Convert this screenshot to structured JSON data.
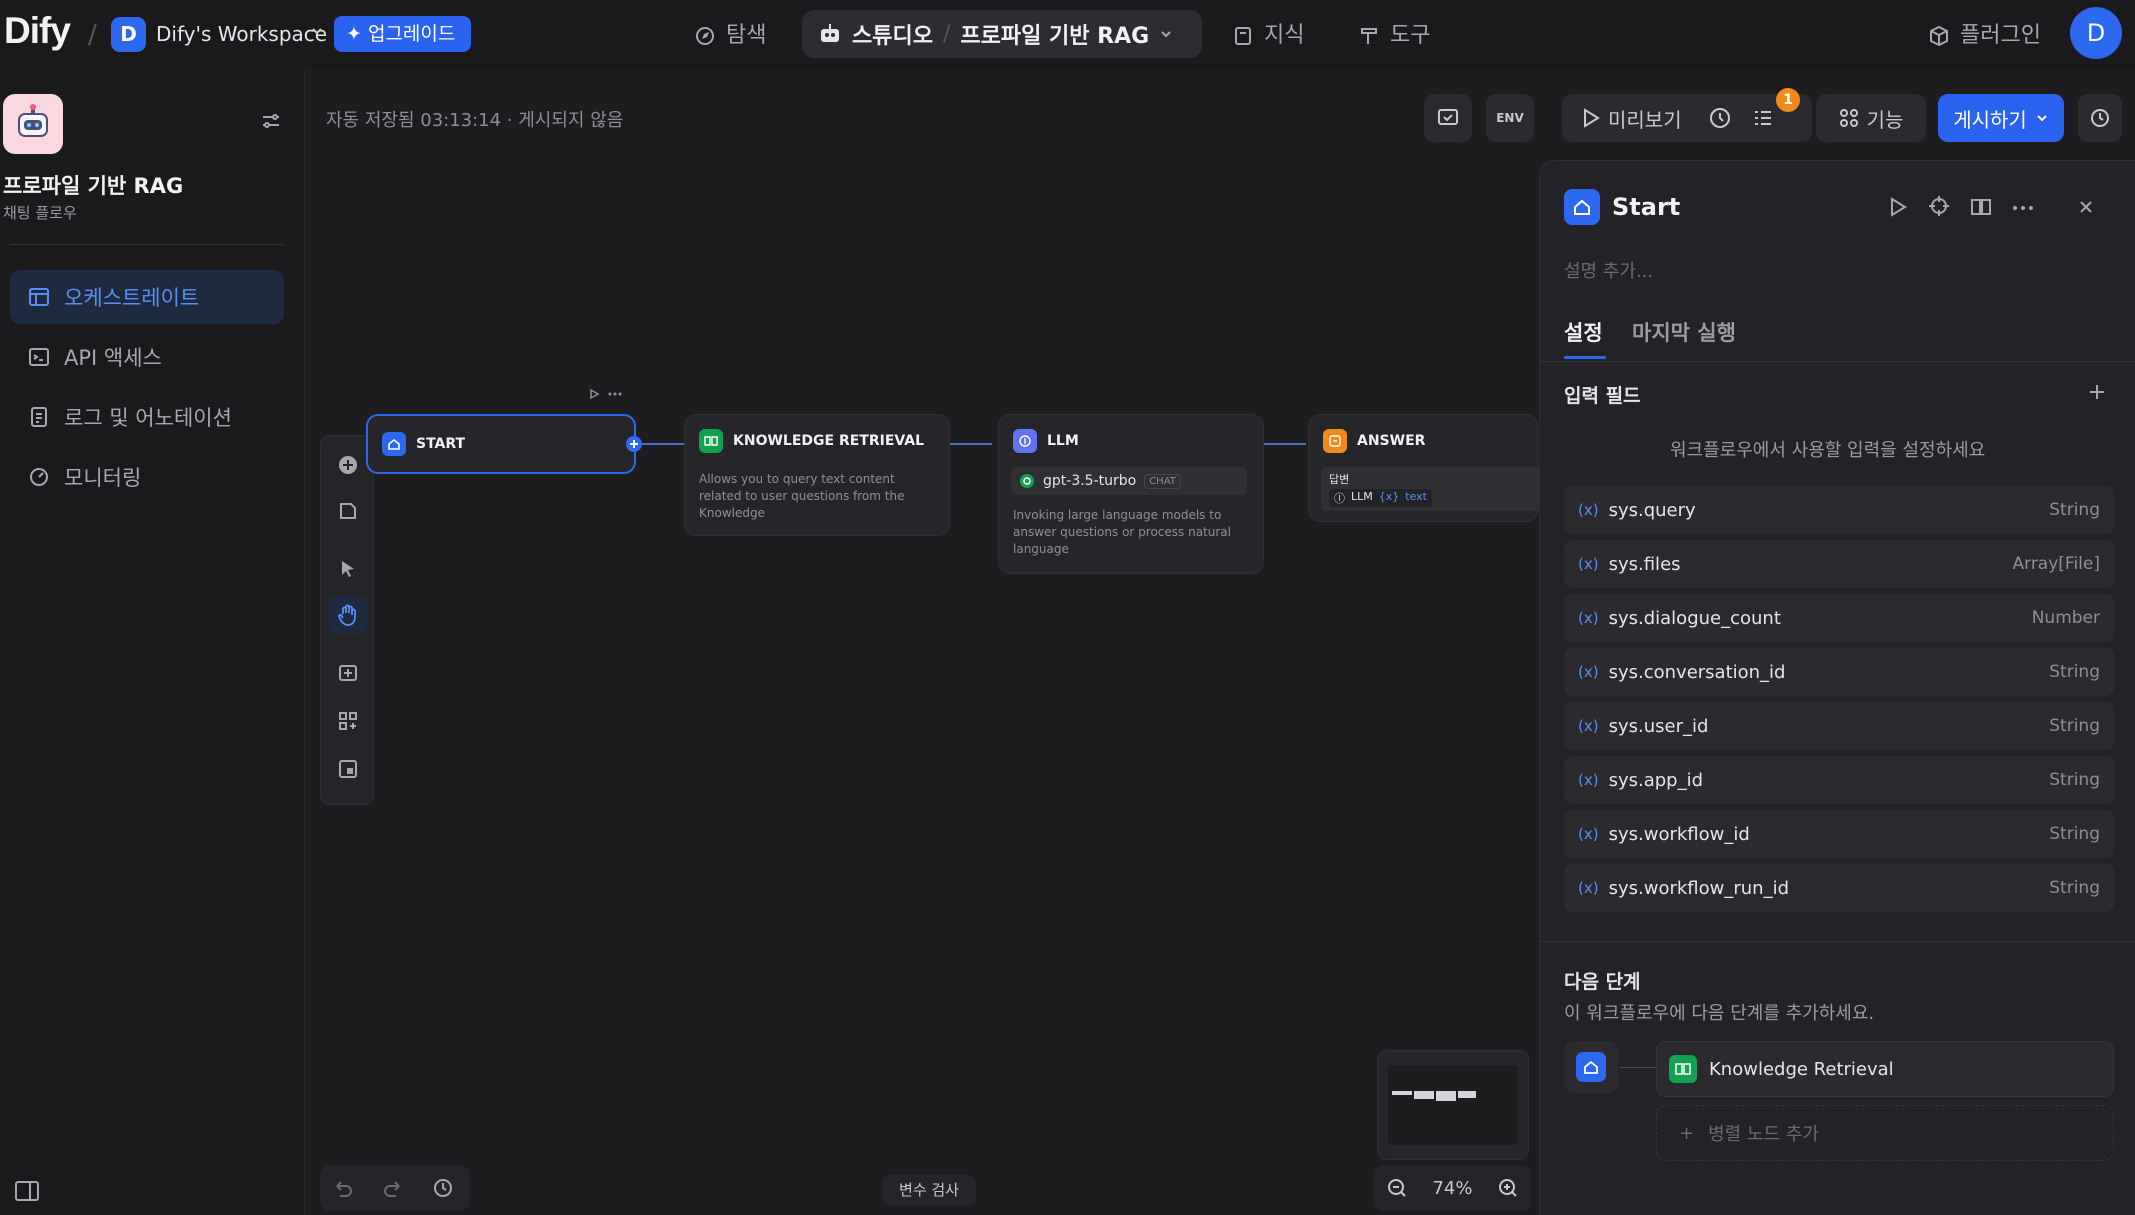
{
  "topbar": {
    "logo": "Dify",
    "workspace_initial": "D",
    "workspace_name": "Dify's Workspace",
    "upgrade_label": "업그레이드",
    "nav_explore": "탐색",
    "nav_studio": "스튜디오",
    "nav_app": "프로파일 기반 RAG",
    "nav_knowledge": "지식",
    "nav_tools": "도구",
    "plugins": "플러그인",
    "user_initial": "D"
  },
  "sidebar": {
    "app_title": "프로파일 기반 RAG",
    "app_subtitle": "채팅 플로우",
    "items": [
      {
        "label": "오케스트레이트",
        "icon": "orchestrate-icon"
      },
      {
        "label": "API 액세스",
        "icon": "terminal-icon"
      },
      {
        "label": "로그 및 어노테이션",
        "icon": "logs-icon"
      },
      {
        "label": "모니터링",
        "icon": "monitor-icon"
      }
    ]
  },
  "canvas": {
    "autosave": "자동 저장됨 03:13:14 · 게시되지 않음",
    "toolbar": {
      "env": "ENV",
      "preview": "미리보기",
      "badge": "1",
      "features": "기능",
      "publish": "게시하기"
    },
    "nodes": {
      "start": {
        "title": "START"
      },
      "knowledge": {
        "title": "KNOWLEDGE RETRIEVAL",
        "desc": "Allows you to query text content related to user questions from the Knowledge"
      },
      "llm": {
        "title": "LLM",
        "model": "gpt-3.5-turbo",
        "model_tag": "CHAT",
        "desc": "Invoking large language models to answer questions or process natural language"
      },
      "answer": {
        "title": "ANSWER",
        "label": "답변",
        "ref_node": "LLM",
        "ref_var": "text"
      }
    },
    "var_check": "변수 검사",
    "zoom": "74%"
  },
  "panel": {
    "title": "Start",
    "description_placeholder": "설명 추가...",
    "tab_settings": "설정",
    "tab_last_run": "마지막 실행",
    "input_fields_title": "입력 필드",
    "input_fields_hint": "워크플로우에서 사용할 입력을 설정하세요",
    "variables": [
      {
        "name": "sys.query",
        "type": "String"
      },
      {
        "name": "sys.files",
        "type": "Array[File]"
      },
      {
        "name": "sys.dialogue_count",
        "type": "Number"
      },
      {
        "name": "sys.conversation_id",
        "type": "String"
      },
      {
        "name": "sys.user_id",
        "type": "String"
      },
      {
        "name": "sys.app_id",
        "type": "String"
      },
      {
        "name": "sys.workflow_id",
        "type": "String"
      },
      {
        "name": "sys.workflow_run_id",
        "type": "String"
      }
    ],
    "next_step_title": "다음 단계",
    "next_step_hint": "이 워크플로우에 다음 단계를 추가하세요.",
    "next_node": "Knowledge Retrieval",
    "add_parallel": "병렬 노드 추가"
  },
  "colors": {
    "accent": "#2c69f0",
    "knowledge": "#12a150",
    "llm": "#6172f3",
    "answer": "#f08a1c"
  }
}
